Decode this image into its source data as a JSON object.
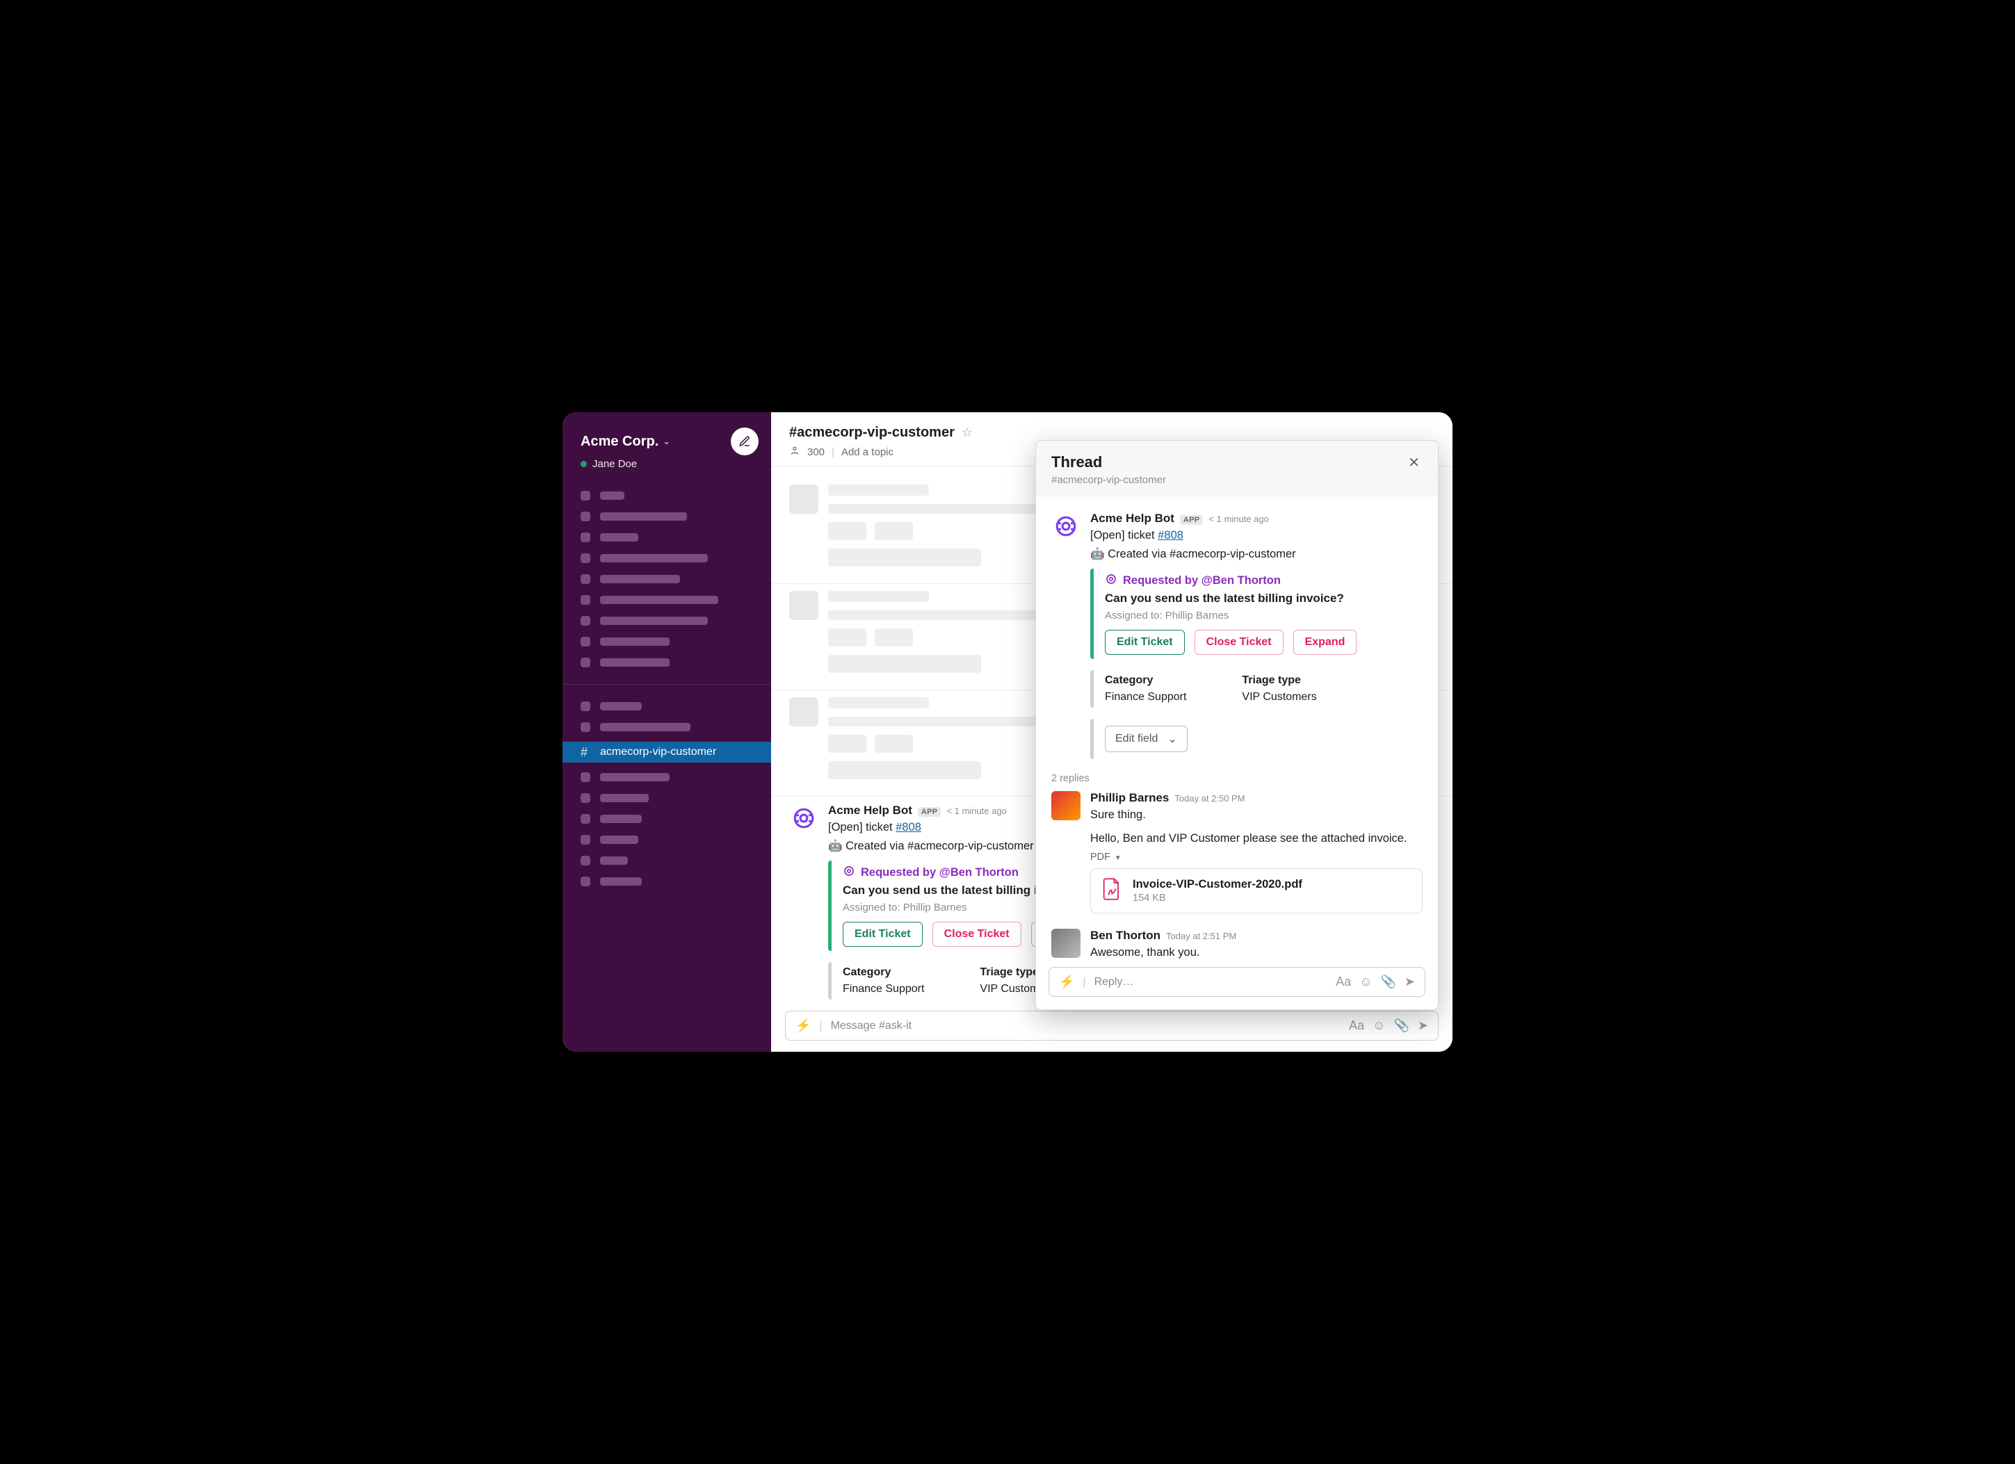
{
  "workspace": {
    "name": "Acme Corp.",
    "user": "Jane Doe"
  },
  "sidebar": {
    "selected_channel_label": "acmecorp-vip-customer",
    "skeleton_section_a_widths": [
      35,
      125,
      55,
      155,
      115,
      170,
      155,
      100,
      100
    ],
    "skeleton_section_b_widths": [
      60,
      130
    ],
    "skeleton_section_c_widths": [
      100,
      70,
      60,
      55,
      40,
      60
    ]
  },
  "channel": {
    "name": "#acmecorp-vip-customer",
    "member_count": "300",
    "topic_placeholder": "Add a topic",
    "composer_placeholder": "Message #ask-it"
  },
  "skeleton_messages": [
    {
      "first": 145,
      "second": 620,
      "chips": [
        55,
        55
      ],
      "third": 220
    },
    {
      "first": 145,
      "second": 620,
      "chips": [
        55,
        55
      ],
      "third": 220
    },
    {
      "first": 145,
      "second": 620,
      "chips": [
        55,
        55
      ],
      "third": 220
    }
  ],
  "bot_message": {
    "author": "Acme Help Bot",
    "app_tag": "APP",
    "timestamp": "< 1 minute ago",
    "status_prefix": "[Open] ticket ",
    "ticket_link": "#808",
    "created_via_prefix": "🤖 Created via ",
    "created_via_channel": "#acmecorp-vip-customer",
    "requested_by": "Requested by @Ben Thorton",
    "ticket_title": "Can you send us the latest billing invoice?",
    "assigned_label": "Assigned to: Phillip Barnes",
    "buttons": {
      "edit": "Edit Ticket",
      "close": "Close Ticket",
      "expand": "Expand"
    },
    "category_label": "Category",
    "category_value": "Finance Support",
    "triage_label": "Triage type",
    "triage_value": "VIP Customers",
    "edit_field_label": "Edit field"
  },
  "thread": {
    "title": "Thread",
    "channel": "#acmecorp-vip-customer",
    "replies_label": "2 replies",
    "reply_placeholder": "Reply…",
    "replies": [
      {
        "author": "Phillip Barnes",
        "timestamp": "Today at 2:50 PM",
        "line1": "Sure thing.",
        "line2": "Hello, Ben and VIP Customer please see the attached invoice.",
        "attachment_type": "PDF",
        "file_name": "Invoice-VIP-Customer-2020.pdf",
        "file_size": "154 KB"
      },
      {
        "author": "Ben Thorton",
        "timestamp": "Today at 2:51 PM",
        "line1": "Awesome, thank you."
      }
    ]
  }
}
